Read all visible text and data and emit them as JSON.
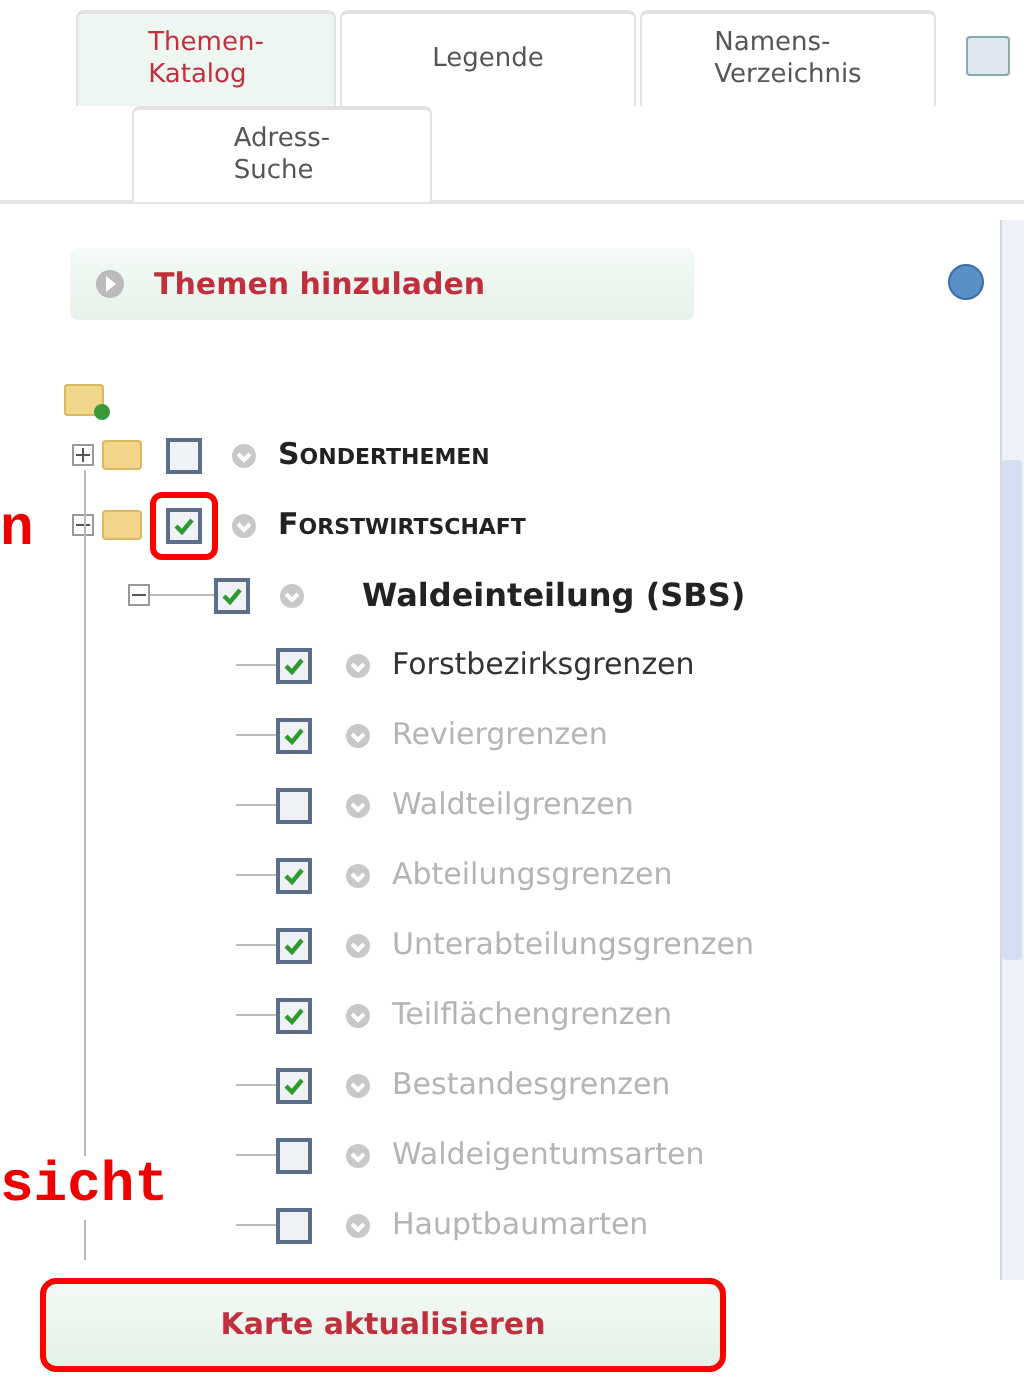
{
  "tabs": [
    {
      "label": "Themen-\nKatalog",
      "selected": true
    },
    {
      "label": "Legende",
      "selected": false
    },
    {
      "label": "Namens-\nVerzeichnis",
      "selected": false
    },
    {
      "label": "Adress-\nSuche",
      "selected": false
    }
  ],
  "load_button": {
    "label": "Themen hinzuladen"
  },
  "tree": [
    {
      "label": "Sonderthemen",
      "checked": false,
      "expanded": false
    },
    {
      "label": "Forstwirtschaft",
      "checked": true,
      "expanded": true,
      "highlighted": true,
      "children": [
        {
          "label": "Waldeinteilung (SBS)",
          "checked": true,
          "expanded": true,
          "children": [
            {
              "label": "Forstbezirksgrenzen",
              "checked": true,
              "dimmed": false
            },
            {
              "label": "Reviergrenzen",
              "checked": true,
              "dimmed": true
            },
            {
              "label": "Waldteilgrenzen",
              "checked": false,
              "dimmed": true
            },
            {
              "label": "Abteilungsgrenzen",
              "checked": true,
              "dimmed": true
            },
            {
              "label": "Unterabteilungsgrenzen",
              "checked": true,
              "dimmed": true
            },
            {
              "label": "Teilflächengrenzen",
              "checked": true,
              "dimmed": true
            },
            {
              "label": "Bestandesgrenzen",
              "checked": true,
              "dimmed": true
            },
            {
              "label": "Waldeigentumsarten",
              "checked": false,
              "dimmed": true
            },
            {
              "label": "Hauptbaumarten",
              "checked": false,
              "dimmed": true
            }
          ]
        }
      ]
    }
  ],
  "update_button": {
    "label": "Karte aktualisieren",
    "highlighted": true
  },
  "annotations": [
    {
      "text": "n"
    },
    {
      "text": "sicht"
    }
  ]
}
